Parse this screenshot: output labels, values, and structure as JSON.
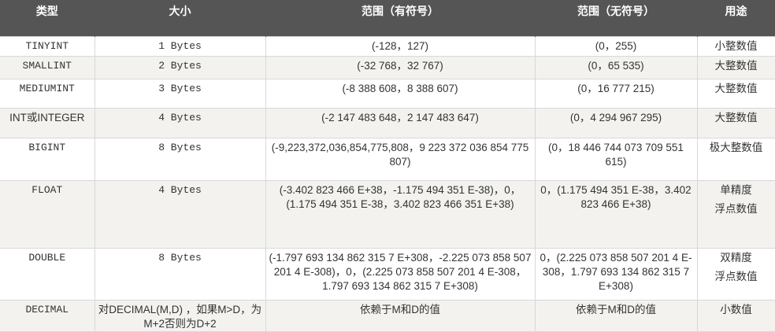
{
  "headers": [
    "类型",
    "大小",
    "范围（有符号）",
    "范围（无符号）",
    "用途"
  ],
  "colors": {
    "header_bg": "#555555",
    "stripe_bg": "#f3f2ef"
  },
  "rows": [
    {
      "type": "TINYINT",
      "size": "1 Bytes",
      "signed": "(-128，127)",
      "unsigned": "(0，255)",
      "use": "小整数值"
    },
    {
      "type": "SMALLINT",
      "size": "2 Bytes",
      "signed": "(-32 768，32 767)",
      "unsigned": "(0，65 535)",
      "use": "大整数值"
    },
    {
      "type": "MEDIUMINT",
      "size": "3 Bytes",
      "signed": "(-8 388 608，8 388 607)",
      "unsigned": "(0，16 777 215)",
      "use": "大整数值"
    },
    {
      "type": "INT或INTEGER",
      "size": "4 Bytes",
      "signed": "(-2 147 483 648，2 147 483 647)",
      "unsigned": "(0，4 294 967 295)",
      "use": "大整数值"
    },
    {
      "type": "BIGINT",
      "size": "8 Bytes",
      "signed": "(-9,223,372,036,854,775,808，9 223 372 036 854 775 807)",
      "unsigned": "(0，18 446 744 073 709 551 615)",
      "use": "极大整数值"
    },
    {
      "type": "FLOAT",
      "size": "4 Bytes",
      "signed": "(-3.402 823 466 E+38，-1.175 494 351 E-38)，0，(1.175 494 351 E-38，3.402 823 466 351 E+38)",
      "unsigned": "0，(1.175 494 351 E-38，3.402 823 466 E+38)",
      "use": "单精度\n浮点数值"
    },
    {
      "type": "DOUBLE",
      "size": "8 Bytes",
      "signed": "(-1.797 693 134 862 315 7 E+308，-2.225 073 858 507 201 4 E-308)，0，(2.225 073 858 507 201 4 E-308，1.797 693 134 862 315 7 E+308)",
      "unsigned": "0，(2.225 073 858 507 201 4 E-308，1.797 693 134 862 315 7 E+308)",
      "use": "双精度\n浮点数值"
    },
    {
      "type": "DECIMAL",
      "size": "对DECIMAL(M,D) ，如果M>D，为M+2否则为D+2",
      "signed": "依赖于M和D的值",
      "unsigned": "依赖于M和D的值",
      "use": "小数值"
    }
  ]
}
